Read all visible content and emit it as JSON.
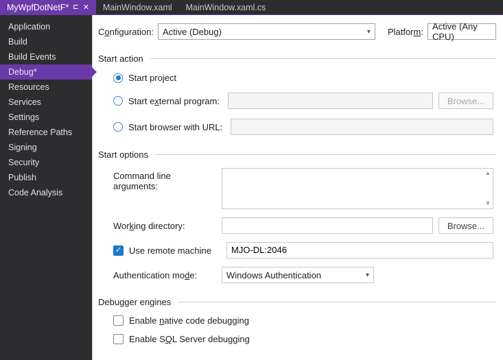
{
  "tabs": {
    "active": "MyWpfDotNetF*",
    "t1": "MainWindow.xaml",
    "t2": "MainWindow.xaml.cs"
  },
  "sidebar": {
    "items": [
      "Application",
      "Build",
      "Build Events",
      "Debug*",
      "Resources",
      "Services",
      "Settings",
      "Reference Paths",
      "Signing",
      "Security",
      "Publish",
      "Code Analysis"
    ],
    "selectedIndex": 3
  },
  "header": {
    "config_label_pre": "C",
    "config_label_u": "o",
    "config_label_post": "nfiguration:",
    "config_value": "Active (Debug)",
    "platform_label_pre": "Platfor",
    "platform_label_u": "m",
    "platform_label_post": ":",
    "platform_value": "Active (Any CPU)"
  },
  "start_action": {
    "title": "Start action",
    "opt_project": "Start project",
    "opt_ext_pre": "Start e",
    "opt_ext_u": "x",
    "opt_ext_post": "ternal program:",
    "opt_url": "Start browser with URL:",
    "browse": "Browse..."
  },
  "start_options": {
    "title": "Start options",
    "cla_pre": "Command line ar",
    "cla_u": "g",
    "cla_post": "uments:",
    "wd_pre": "Wor",
    "wd_u": "k",
    "wd_post": "ing directory:",
    "browse": "Browse...",
    "remote": "Use remote machine",
    "remote_value": "MJO-DL:2046",
    "auth_pre": "Authentication mo",
    "auth_u": "d",
    "auth_post": "e:",
    "auth_value": "Windows Authentication"
  },
  "debugger_engines": {
    "title": "Debugger engines",
    "native_pre": "Enable ",
    "native_u": "n",
    "native_post": "ative code debugging",
    "sql_pre": "Enable S",
    "sql_u": "Q",
    "sql_post": "L Server debugging"
  }
}
